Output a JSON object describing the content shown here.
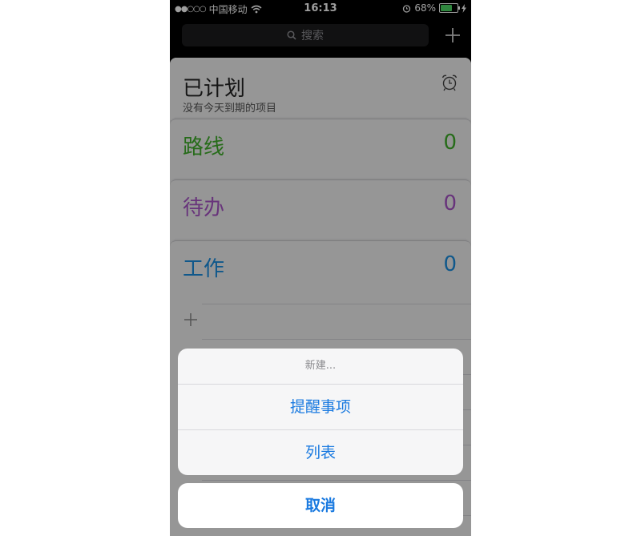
{
  "status_bar": {
    "signal_dots": "●●○○○",
    "carrier": "中国移动",
    "time": "16:13",
    "battery_percent_text": "68%",
    "battery_level": 0.68
  },
  "nav": {
    "search_placeholder": "搜索",
    "search_icon": "magnifier-icon",
    "add_icon": "plus-icon"
  },
  "scheduled": {
    "title": "已计划",
    "subtitle": "没有今天到期的项目",
    "icon": "alarm-clock-icon"
  },
  "lists": [
    {
      "name": "路线",
      "count": "0",
      "color": "#3fae2a"
    },
    {
      "name": "待办",
      "count": "0",
      "color": "#a855c7"
    },
    {
      "name": "工作",
      "count": "0",
      "color": "#1a8fe0"
    }
  ],
  "action_sheet": {
    "title": "新建...",
    "actions": [
      "提醒事项",
      "列表"
    ],
    "cancel": "取消",
    "accent_color": "#1a7ae0"
  }
}
